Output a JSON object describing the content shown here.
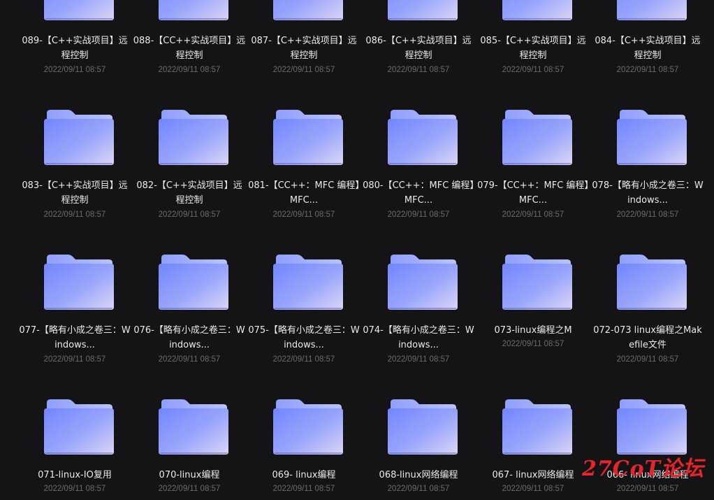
{
  "folders": [
    {
      "name": "089-【C++实战项目】远程控制",
      "date": "2022/09/11 08:57"
    },
    {
      "name": "088-【CC++实战项目】远程控制",
      "date": "2022/09/11 08:57"
    },
    {
      "name": "087-【C++实战项目】远程控制",
      "date": "2022/09/11 08:57"
    },
    {
      "name": "086-【C++实战项目】远程控制",
      "date": "2022/09/11 08:57"
    },
    {
      "name": "085-【C++实战项目】远程控制",
      "date": "2022/09/11 08:57"
    },
    {
      "name": "084-【C++实战项目】远程控制",
      "date": "2022/09/11 08:57"
    },
    {
      "name": "083-【C++实战项目】远程控制",
      "date": "2022/09/11 08:57"
    },
    {
      "name": "082-【C++实战项目】远程控制",
      "date": "2022/09/11 08:57"
    },
    {
      "name": "081-【CC++：MFC 编程】MFC...",
      "date": "2022/09/11 08:57"
    },
    {
      "name": "080-【CC++：MFC 编程】MFC...",
      "date": "2022/09/11 08:57"
    },
    {
      "name": "079-【CC++：MFC 编程】MFC...",
      "date": "2022/09/11 08:57"
    },
    {
      "name": "078-【略有小成之卷三：Windows...",
      "date": "2022/09/11 08:57"
    },
    {
      "name": "077-【略有小成之卷三：Windows...",
      "date": "2022/09/11 08:57"
    },
    {
      "name": "076-【略有小成之卷三：Windows...",
      "date": "2022/09/11 08:57"
    },
    {
      "name": "075-【略有小成之卷三：Windows...",
      "date": "2022/09/11 08:57"
    },
    {
      "name": "074-【略有小成之卷三：Windows...",
      "date": "2022/09/11 08:57"
    },
    {
      "name": "073-linux编程之M",
      "date": "2022/09/11 08:57"
    },
    {
      "name": "072-073 linux编程之Makefile文件",
      "date": "2022/09/11 08:57"
    },
    {
      "name": "071-linux-IO复用",
      "date": "2022/09/11 08:57"
    },
    {
      "name": "070-linux编程",
      "date": "2022/09/11 08:57"
    },
    {
      "name": "069- linux编程",
      "date": "2022/09/11 08:57"
    },
    {
      "name": "068-linux网络编程",
      "date": "2022/09/11 08:57"
    },
    {
      "name": "067- linux网络编程",
      "date": "2022/09/11 08:57"
    },
    {
      "name": "066- linux网络编程",
      "date": "2022/09/11 08:57"
    }
  ],
  "watermark": "27CoT论坛",
  "colors": {
    "background": "#141416",
    "folder_front_start": "#7b8cff",
    "folder_front_end": "#d9d3f7",
    "folder_back": "#a6b4fb",
    "name_text": "#eaeaea",
    "date_text": "#6b6b70",
    "watermark": "#e8242a"
  }
}
